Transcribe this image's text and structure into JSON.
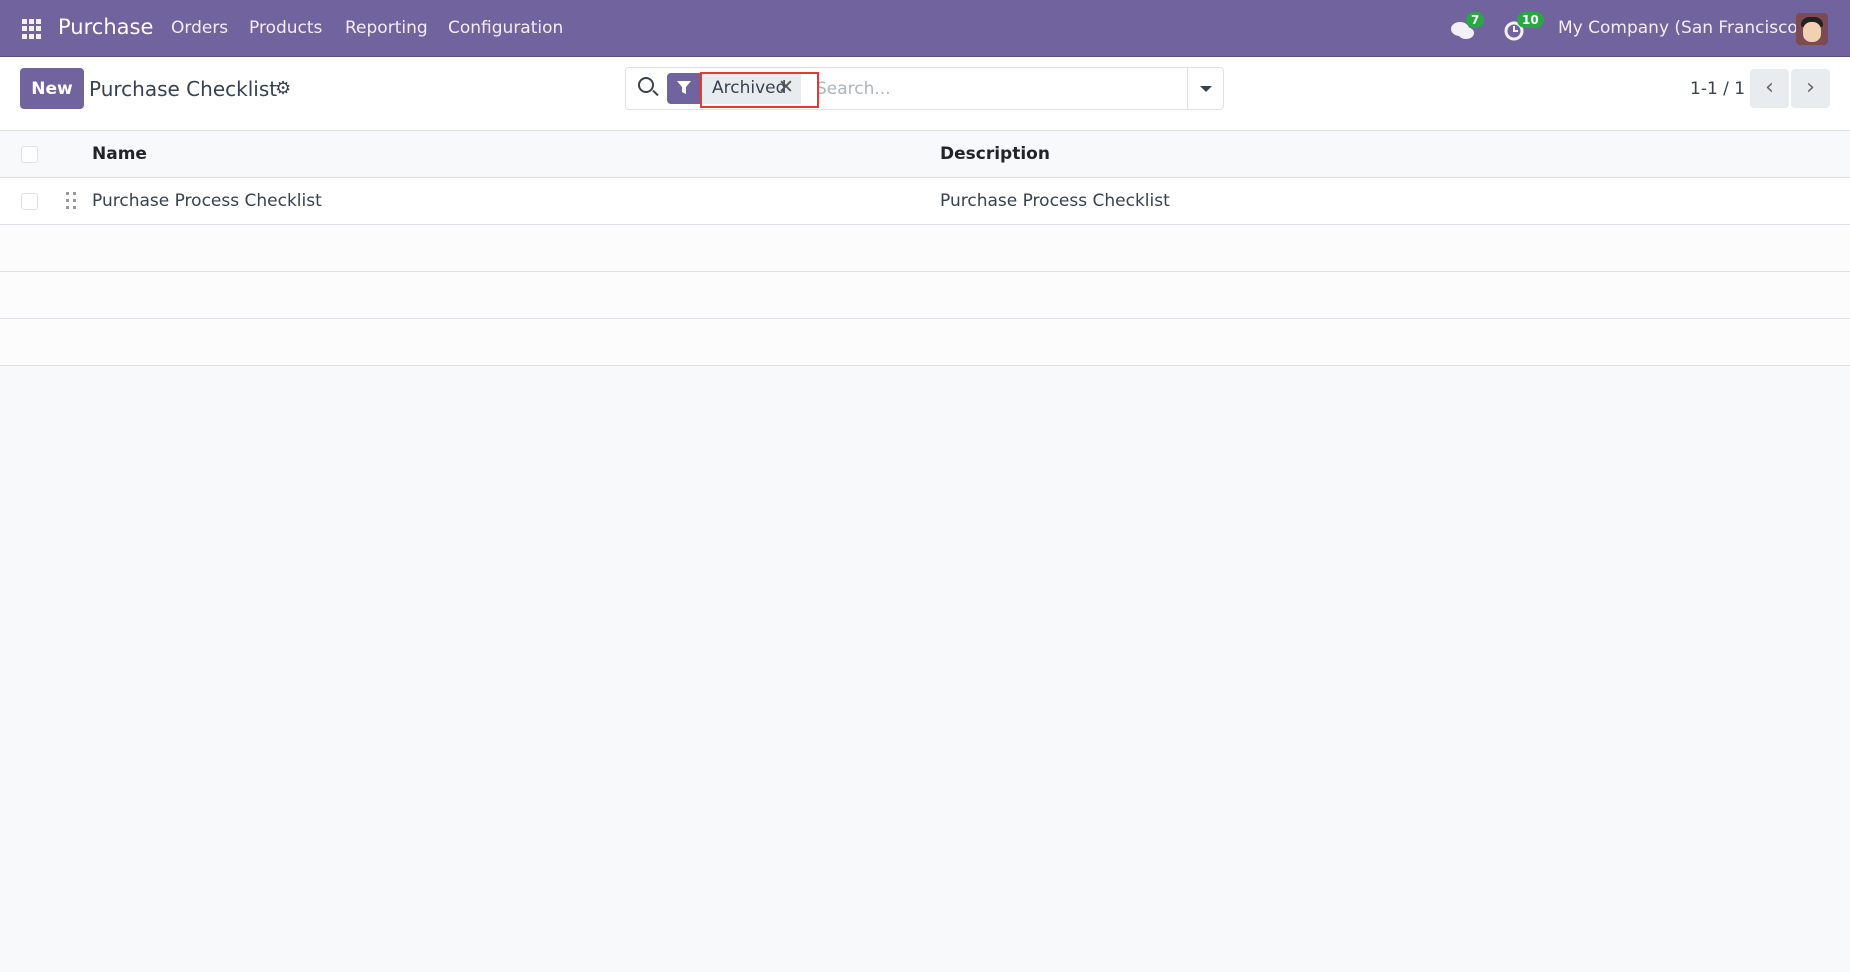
{
  "navbar": {
    "app_name": "Purchase",
    "menu": [
      "Orders",
      "Products",
      "Reporting",
      "Configuration"
    ],
    "messages_count": "7",
    "activities_count": "10",
    "company": "My Company (San Francisco)",
    "accent": "#71639e"
  },
  "control_panel": {
    "new_label": "New",
    "title": "Purchase Checklist",
    "search": {
      "facet": "Archived",
      "placeholder": "Search..."
    },
    "pager": "1-1 / 1"
  },
  "table": {
    "columns": [
      "Name",
      "Description"
    ],
    "rows": [
      {
        "name": "Purchase Process Checklist",
        "description": "Purchase Process Checklist"
      }
    ]
  }
}
